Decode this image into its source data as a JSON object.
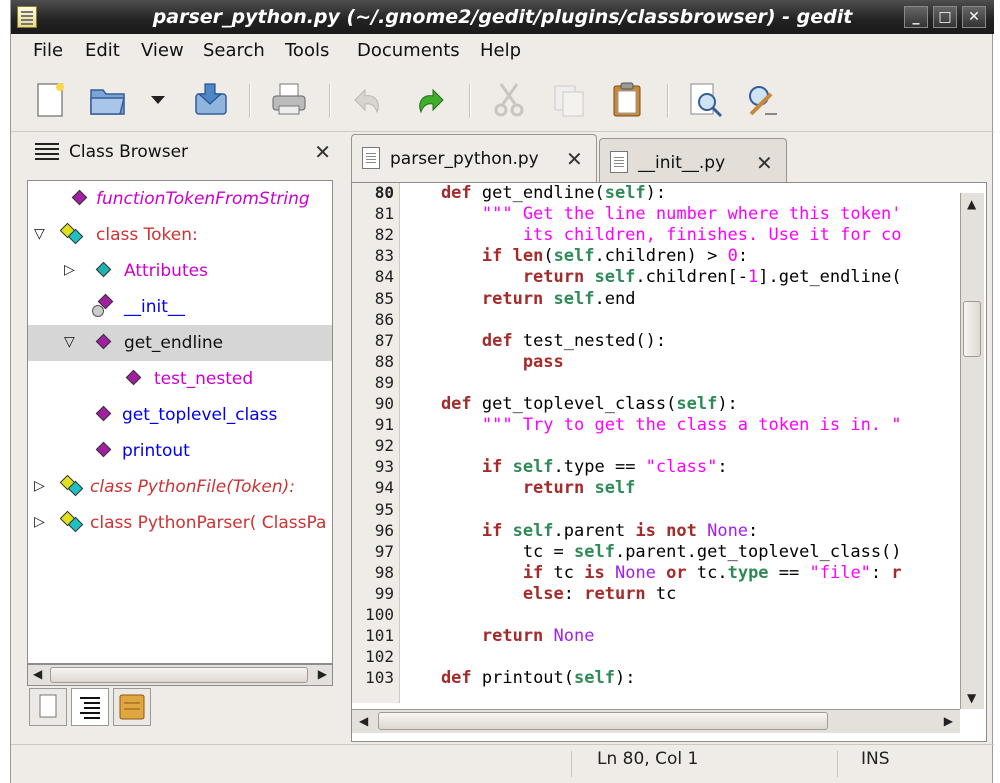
{
  "window": {
    "title": "parser_python.py (~/.gnome2/gedit/plugins/classbrowser) - gedit",
    "minimize": "_",
    "maximize": "□",
    "close": "✕"
  },
  "menu": [
    "File",
    "Edit",
    "View",
    "Search",
    "Tools",
    "Documents",
    "Help"
  ],
  "toolbar": {
    "buttons": [
      "new-document",
      "open",
      "open-recent",
      "save",
      "print",
      "undo",
      "redo",
      "cut",
      "copy",
      "paste",
      "find",
      "find-replace"
    ]
  },
  "side_panel": {
    "title": "Class Browser",
    "close": "✕",
    "tree": [
      {
        "label": "functionTokenFromString",
        "color": "#cc00cc",
        "italic": true,
        "expander": "",
        "icon": "method-diamond-icon"
      },
      {
        "label": "class Token:",
        "color": "#cc3333",
        "italic": false,
        "expander": "▽",
        "icon": "class-diamonds-icon"
      },
      {
        "label": "Attributes",
        "color": "#cc00cc",
        "italic": false,
        "expander": "▷",
        "icon": "attributes-diamond-icon"
      },
      {
        "label": "__init__",
        "color": "#0000ee",
        "italic": false,
        "expander": "",
        "icon": "constructor-icon"
      },
      {
        "label": "get_endline",
        "color": "#111111",
        "italic": false,
        "expander": "▽",
        "icon": "method-diamond-icon",
        "selected": true
      },
      {
        "label": "test_nested",
        "color": "#cc00cc",
        "italic": false,
        "expander": "",
        "icon": "method-diamond-icon"
      },
      {
        "label": "get_toplevel_class",
        "color": "#0000ee",
        "italic": false,
        "expander": "",
        "icon": "method-diamond-icon"
      },
      {
        "label": "printout",
        "color": "#0000ee",
        "italic": false,
        "expander": "",
        "icon": "method-diamond-icon"
      },
      {
        "label": "class PythonFile(Token):",
        "color": "#cc3333",
        "italic": true,
        "expander": "▷",
        "icon": "class-diamonds-icon"
      },
      {
        "label": "class PythonParser( ClassPa",
        "color": "#cc3333",
        "italic": false,
        "expander": "▷",
        "icon": "class-diamonds-icon"
      }
    ],
    "tabs": [
      "documents-tab",
      "class-browser-tab",
      "file-browser-tab"
    ]
  },
  "editor": {
    "tabs": [
      {
        "label": "parser_python.py",
        "active": true
      },
      {
        "label": "__init__.py",
        "active": false
      }
    ],
    "current_line": 80,
    "lines": [
      {
        "no": "80",
        "segments": [
          [
            "kw",
            "    def "
          ],
          [
            "",
            "get_endline("
          ],
          [
            "self",
            "self"
          ],
          [
            "",
            "):"
          ]
        ]
      },
      {
        "no": "81",
        "segments": [
          [
            "str",
            "        \"\"\" Get the line number where this token'"
          ]
        ]
      },
      {
        "no": "82",
        "segments": [
          [
            "str",
            "            its children, finishes. Use it for co"
          ]
        ]
      },
      {
        "no": "83",
        "segments": [
          [
            "kw",
            "        if "
          ],
          [
            "kw",
            "len"
          ],
          [
            "",
            "("
          ],
          [
            "self",
            "self"
          ],
          [
            "",
            ".children) > "
          ],
          [
            "num",
            "0"
          ],
          [
            "",
            ":"
          ]
        ]
      },
      {
        "no": "84",
        "segments": [
          [
            "kw",
            "            return "
          ],
          [
            "self",
            "self"
          ],
          [
            "",
            ".children[-"
          ],
          [
            "num",
            "1"
          ],
          [
            "",
            "].get_endline("
          ]
        ]
      },
      {
        "no": "85",
        "segments": [
          [
            "kw",
            "        return "
          ],
          [
            "self",
            "self"
          ],
          [
            "",
            ".end"
          ]
        ]
      },
      {
        "no": "86",
        "segments": [
          [
            "",
            ""
          ]
        ]
      },
      {
        "no": "87",
        "segments": [
          [
            "kw",
            "        def "
          ],
          [
            "",
            "test_nested():"
          ]
        ]
      },
      {
        "no": "88",
        "segments": [
          [
            "kw",
            "            pass"
          ]
        ]
      },
      {
        "no": "89",
        "segments": [
          [
            "",
            ""
          ]
        ]
      },
      {
        "no": "90",
        "segments": [
          [
            "kw",
            "    def "
          ],
          [
            "",
            "get_toplevel_class("
          ],
          [
            "self",
            "self"
          ],
          [
            "",
            "):"
          ]
        ]
      },
      {
        "no": "91",
        "segments": [
          [
            "str",
            "        \"\"\" Try to get the class a token is in. \""
          ]
        ]
      },
      {
        "no": "92",
        "segments": [
          [
            "",
            ""
          ]
        ]
      },
      {
        "no": "93",
        "segments": [
          [
            "kw",
            "        if "
          ],
          [
            "self",
            "self"
          ],
          [
            "",
            ".type == "
          ],
          [
            "str",
            "\"class\""
          ],
          [
            "",
            ":"
          ]
        ]
      },
      {
        "no": "94",
        "segments": [
          [
            "kw",
            "            return "
          ],
          [
            "self",
            "self"
          ]
        ]
      },
      {
        "no": "95",
        "segments": [
          [
            "",
            ""
          ]
        ]
      },
      {
        "no": "96",
        "segments": [
          [
            "kw",
            "        if "
          ],
          [
            "self",
            "self"
          ],
          [
            "",
            ".parent "
          ],
          [
            "kw",
            "is not "
          ],
          [
            "const",
            "None"
          ],
          [
            "",
            ":"
          ]
        ]
      },
      {
        "no": "97",
        "segments": [
          [
            "",
            "            tc = "
          ],
          [
            "self",
            "self"
          ],
          [
            "",
            ".parent.get_toplevel_class()"
          ]
        ]
      },
      {
        "no": "98",
        "segments": [
          [
            "kw",
            "            if "
          ],
          [
            "",
            "tc "
          ],
          [
            "kw",
            "is "
          ],
          [
            "const",
            "None "
          ],
          [
            "kw",
            "or "
          ],
          [
            "",
            "tc."
          ],
          [
            "self",
            "type"
          ],
          [
            "",
            " == "
          ],
          [
            "str",
            "\"file\""
          ],
          [
            "",
            ": "
          ],
          [
            "kw",
            "r"
          ]
        ]
      },
      {
        "no": "99",
        "segments": [
          [
            "kw",
            "            else"
          ],
          [
            "",
            ": "
          ],
          [
            "kw",
            "return "
          ],
          [
            "",
            "tc"
          ]
        ]
      },
      {
        "no": "100",
        "segments": [
          [
            "",
            ""
          ]
        ]
      },
      {
        "no": "101",
        "segments": [
          [
            "kw",
            "        return "
          ],
          [
            "const",
            "None"
          ]
        ]
      },
      {
        "no": "102",
        "segments": [
          [
            "",
            ""
          ]
        ]
      },
      {
        "no": "103",
        "segments": [
          [
            "kw",
            "    def "
          ],
          [
            "",
            "printout("
          ],
          [
            "self",
            "self"
          ],
          [
            "",
            "):"
          ]
        ]
      }
    ]
  },
  "status": {
    "position": "Ln 80, Col 1",
    "mode": "INS"
  },
  "colors": {
    "keyword": "#a52a2a",
    "self": "#2e8b57",
    "string": "#ff00ff",
    "constant": "#a020f0"
  }
}
